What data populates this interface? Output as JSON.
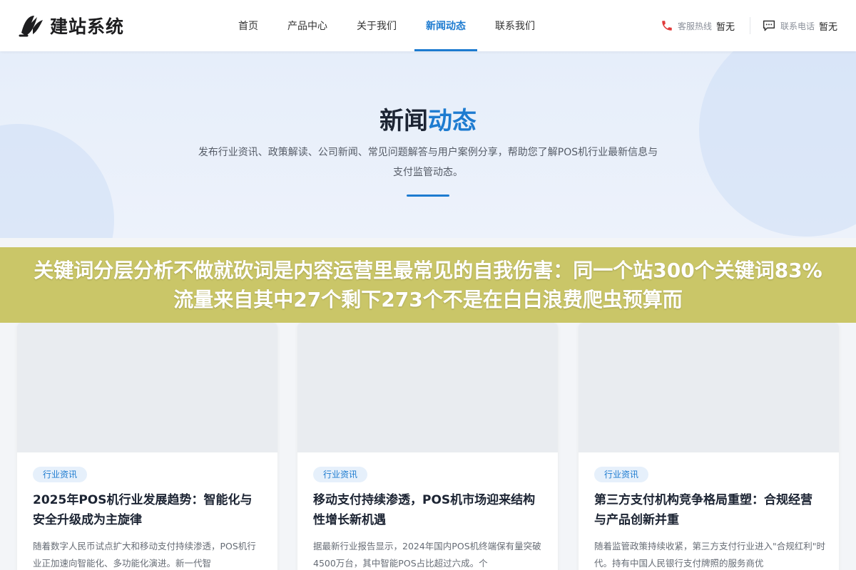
{
  "header": {
    "logo_text": "建站系统",
    "nav": [
      {
        "label": "首页"
      },
      {
        "label": "产品中心"
      },
      {
        "label": "关于我们"
      },
      {
        "label": "新闻动态",
        "active": true
      },
      {
        "label": "联系我们"
      }
    ],
    "hotline": {
      "label": "客服热线",
      "value": "暂无",
      "icon": "phone-icon"
    },
    "contact_phone": {
      "label": "联系电话",
      "value": "暂无",
      "icon": "message-icon"
    }
  },
  "hero": {
    "title_main": "新闻",
    "title_accent": "动态",
    "description": "发布行业资讯、政策解读、公司新闻、常见问题解答与用户案例分享，帮助您了解POS机行业最新信息与支付监管动态。"
  },
  "banner": {
    "text": "关键词分层分析不做就砍词是内容运营里最常见的自我伤害：同一个站300个关键词83%流量来自其中27个剩下273个不是在白白浪费爬虫预算而"
  },
  "cards": [
    {
      "tag": "行业资讯",
      "title": "2025年POS机行业发展趋势：智能化与安全升级成为主旋律",
      "excerpt": "随着数字人民币试点扩大和移动支付持续渗透，POS机行业正加速向智能化、多功能化演进。新一代智"
    },
    {
      "tag": "行业资讯",
      "title": "移动支付持续渗透，POS机市场迎来结构性增长新机遇",
      "excerpt": "据最新行业报告显示，2024年国内POS机终端保有量突破4500万台，其中智能POS占比超过六成。个"
    },
    {
      "tag": "行业资讯",
      "title": "第三方支付机构竞争格局重塑：合规经营与产品创新并重",
      "excerpt": "随着监管政策持续收紧，第三方支付行业进入\"合规红利\"时代。持有中国人民银行支付牌照的服务商优"
    }
  ],
  "colors": {
    "accent": "#1d7bd0",
    "banner": "#c6c25c",
    "hero_bg": "#e6eefa"
  }
}
